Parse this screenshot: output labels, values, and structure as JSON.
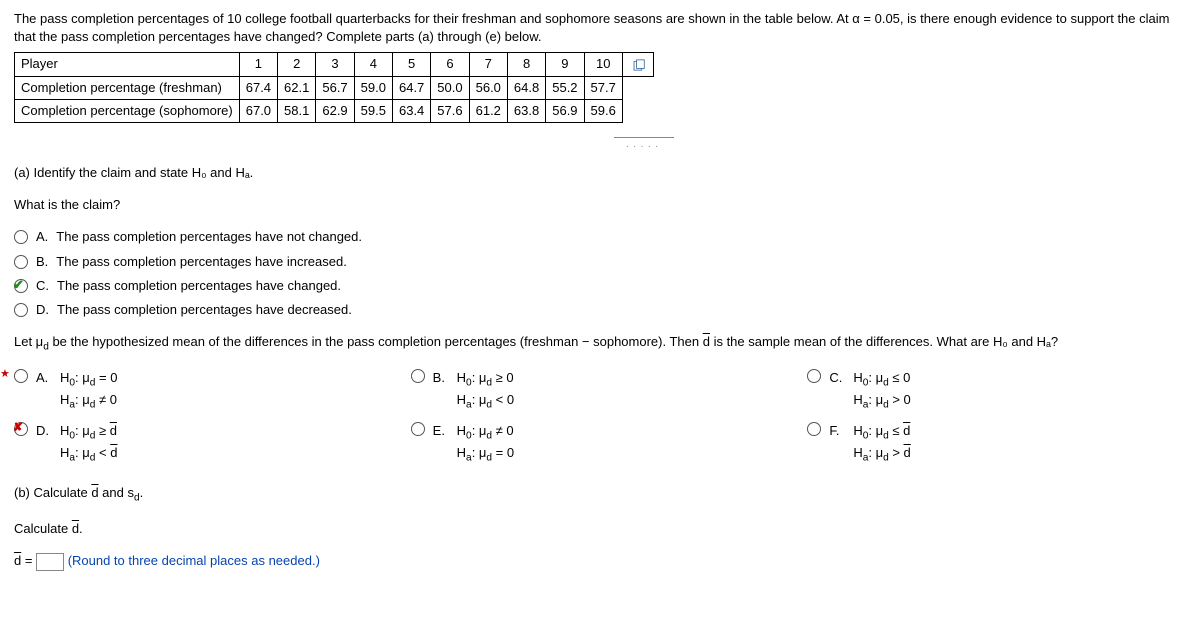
{
  "intro": "The pass completion percentages of 10 college football quarterbacks for their freshman and sophomore seasons are shown in the table below. At α = 0.05, is there enough evidence to support the claim that the pass completion percentages have changed? Complete parts (a) through (e) below.",
  "table": {
    "row_player": "Player",
    "row_fresh": "Completion percentage (freshman)",
    "row_soph": "Completion percentage (sophomore)",
    "players": [
      "1",
      "2",
      "3",
      "4",
      "5",
      "6",
      "7",
      "8",
      "9",
      "10"
    ],
    "fresh": [
      "67.4",
      "62.1",
      "56.7",
      "59.0",
      "64.7",
      "50.0",
      "56.0",
      "64.8",
      "55.2",
      "57.7"
    ],
    "soph": [
      "67.0",
      "58.1",
      "62.9",
      "59.5",
      "63.4",
      "57.6",
      "61.2",
      "63.8",
      "56.9",
      "59.6"
    ]
  },
  "partA_head": "(a) Identify the claim and state H₀ and Hₐ.",
  "claim_q": "What is the claim?",
  "claim_opts": {
    "A": "The pass completion percentages have not changed.",
    "B": "The pass completion percentages have increased.",
    "C": "The pass completion percentages have changed.",
    "D": "The pass completion percentages have decreased."
  },
  "let_text_1": "Let μ",
  "let_text_1b": " be the hypothesized mean of the differences in the pass completion percentages (freshman − sophomore). Then ",
  "let_text_2": " is the sample mean of the differences. What are H₀ and Hₐ?",
  "hyp": {
    "A": {
      "h0": "H₀: μd = 0",
      "ha": "Hₐ: μd ≠ 0"
    },
    "B": {
      "h0": "H₀: μd ≥ 0",
      "ha": "Hₐ: μd < 0"
    },
    "C": {
      "h0": "H₀: μd ≤ 0",
      "ha": "Hₐ: μd > 0"
    },
    "D": {
      "h0": "H₀: μd ≥ d̄",
      "ha": "Hₐ: μd < d̄"
    },
    "E": {
      "h0": "H₀: μd ≠ 0",
      "ha": "Hₐ: μd = 0"
    },
    "F": {
      "h0": "H₀: μd ≤ d̄",
      "ha": "Hₐ: μd > d̄"
    }
  },
  "partB_head": "(b) Calculate d̄ and sd.",
  "calc_d_label": "Calculate d̄.",
  "d_eq": "d̄ = ",
  "round_note": "(Round to three decimal places as needed.)"
}
